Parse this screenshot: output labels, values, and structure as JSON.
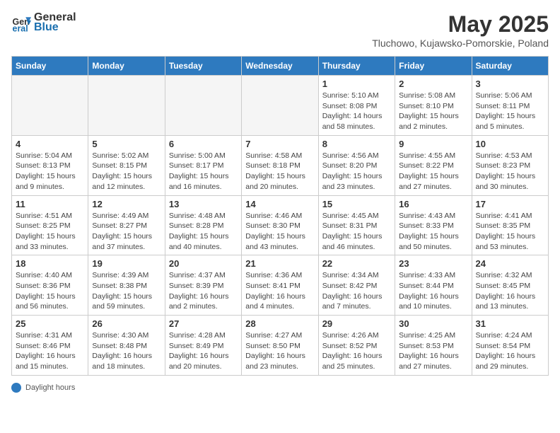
{
  "header": {
    "logo_general": "General",
    "logo_blue": "Blue",
    "month_title": "May 2025",
    "subtitle": "Tluchowo, Kujawsko-Pomorskie, Poland"
  },
  "days_of_week": [
    "Sunday",
    "Monday",
    "Tuesday",
    "Wednesday",
    "Thursday",
    "Friday",
    "Saturday"
  ],
  "footer": {
    "label": "Daylight hours"
  },
  "weeks": [
    [
      {
        "day": "",
        "info": ""
      },
      {
        "day": "",
        "info": ""
      },
      {
        "day": "",
        "info": ""
      },
      {
        "day": "",
        "info": ""
      },
      {
        "day": "1",
        "info": "Sunrise: 5:10 AM\nSunset: 8:08 PM\nDaylight: 14 hours and 58 minutes."
      },
      {
        "day": "2",
        "info": "Sunrise: 5:08 AM\nSunset: 8:10 PM\nDaylight: 15 hours and 2 minutes."
      },
      {
        "day": "3",
        "info": "Sunrise: 5:06 AM\nSunset: 8:11 PM\nDaylight: 15 hours and 5 minutes."
      }
    ],
    [
      {
        "day": "4",
        "info": "Sunrise: 5:04 AM\nSunset: 8:13 PM\nDaylight: 15 hours and 9 minutes."
      },
      {
        "day": "5",
        "info": "Sunrise: 5:02 AM\nSunset: 8:15 PM\nDaylight: 15 hours and 12 minutes."
      },
      {
        "day": "6",
        "info": "Sunrise: 5:00 AM\nSunset: 8:17 PM\nDaylight: 15 hours and 16 minutes."
      },
      {
        "day": "7",
        "info": "Sunrise: 4:58 AM\nSunset: 8:18 PM\nDaylight: 15 hours and 20 minutes."
      },
      {
        "day": "8",
        "info": "Sunrise: 4:56 AM\nSunset: 8:20 PM\nDaylight: 15 hours and 23 minutes."
      },
      {
        "day": "9",
        "info": "Sunrise: 4:55 AM\nSunset: 8:22 PM\nDaylight: 15 hours and 27 minutes."
      },
      {
        "day": "10",
        "info": "Sunrise: 4:53 AM\nSunset: 8:23 PM\nDaylight: 15 hours and 30 minutes."
      }
    ],
    [
      {
        "day": "11",
        "info": "Sunrise: 4:51 AM\nSunset: 8:25 PM\nDaylight: 15 hours and 33 minutes."
      },
      {
        "day": "12",
        "info": "Sunrise: 4:49 AM\nSunset: 8:27 PM\nDaylight: 15 hours and 37 minutes."
      },
      {
        "day": "13",
        "info": "Sunrise: 4:48 AM\nSunset: 8:28 PM\nDaylight: 15 hours and 40 minutes."
      },
      {
        "day": "14",
        "info": "Sunrise: 4:46 AM\nSunset: 8:30 PM\nDaylight: 15 hours and 43 minutes."
      },
      {
        "day": "15",
        "info": "Sunrise: 4:45 AM\nSunset: 8:31 PM\nDaylight: 15 hours and 46 minutes."
      },
      {
        "day": "16",
        "info": "Sunrise: 4:43 AM\nSunset: 8:33 PM\nDaylight: 15 hours and 50 minutes."
      },
      {
        "day": "17",
        "info": "Sunrise: 4:41 AM\nSunset: 8:35 PM\nDaylight: 15 hours and 53 minutes."
      }
    ],
    [
      {
        "day": "18",
        "info": "Sunrise: 4:40 AM\nSunset: 8:36 PM\nDaylight: 15 hours and 56 minutes."
      },
      {
        "day": "19",
        "info": "Sunrise: 4:39 AM\nSunset: 8:38 PM\nDaylight: 15 hours and 59 minutes."
      },
      {
        "day": "20",
        "info": "Sunrise: 4:37 AM\nSunset: 8:39 PM\nDaylight: 16 hours and 2 minutes."
      },
      {
        "day": "21",
        "info": "Sunrise: 4:36 AM\nSunset: 8:41 PM\nDaylight: 16 hours and 4 minutes."
      },
      {
        "day": "22",
        "info": "Sunrise: 4:34 AM\nSunset: 8:42 PM\nDaylight: 16 hours and 7 minutes."
      },
      {
        "day": "23",
        "info": "Sunrise: 4:33 AM\nSunset: 8:44 PM\nDaylight: 16 hours and 10 minutes."
      },
      {
        "day": "24",
        "info": "Sunrise: 4:32 AM\nSunset: 8:45 PM\nDaylight: 16 hours and 13 minutes."
      }
    ],
    [
      {
        "day": "25",
        "info": "Sunrise: 4:31 AM\nSunset: 8:46 PM\nDaylight: 16 hours and 15 minutes."
      },
      {
        "day": "26",
        "info": "Sunrise: 4:30 AM\nSunset: 8:48 PM\nDaylight: 16 hours and 18 minutes."
      },
      {
        "day": "27",
        "info": "Sunrise: 4:28 AM\nSunset: 8:49 PM\nDaylight: 16 hours and 20 minutes."
      },
      {
        "day": "28",
        "info": "Sunrise: 4:27 AM\nSunset: 8:50 PM\nDaylight: 16 hours and 23 minutes."
      },
      {
        "day": "29",
        "info": "Sunrise: 4:26 AM\nSunset: 8:52 PM\nDaylight: 16 hours and 25 minutes."
      },
      {
        "day": "30",
        "info": "Sunrise: 4:25 AM\nSunset: 8:53 PM\nDaylight: 16 hours and 27 minutes."
      },
      {
        "day": "31",
        "info": "Sunrise: 4:24 AM\nSunset: 8:54 PM\nDaylight: 16 hours and 29 minutes."
      }
    ]
  ]
}
